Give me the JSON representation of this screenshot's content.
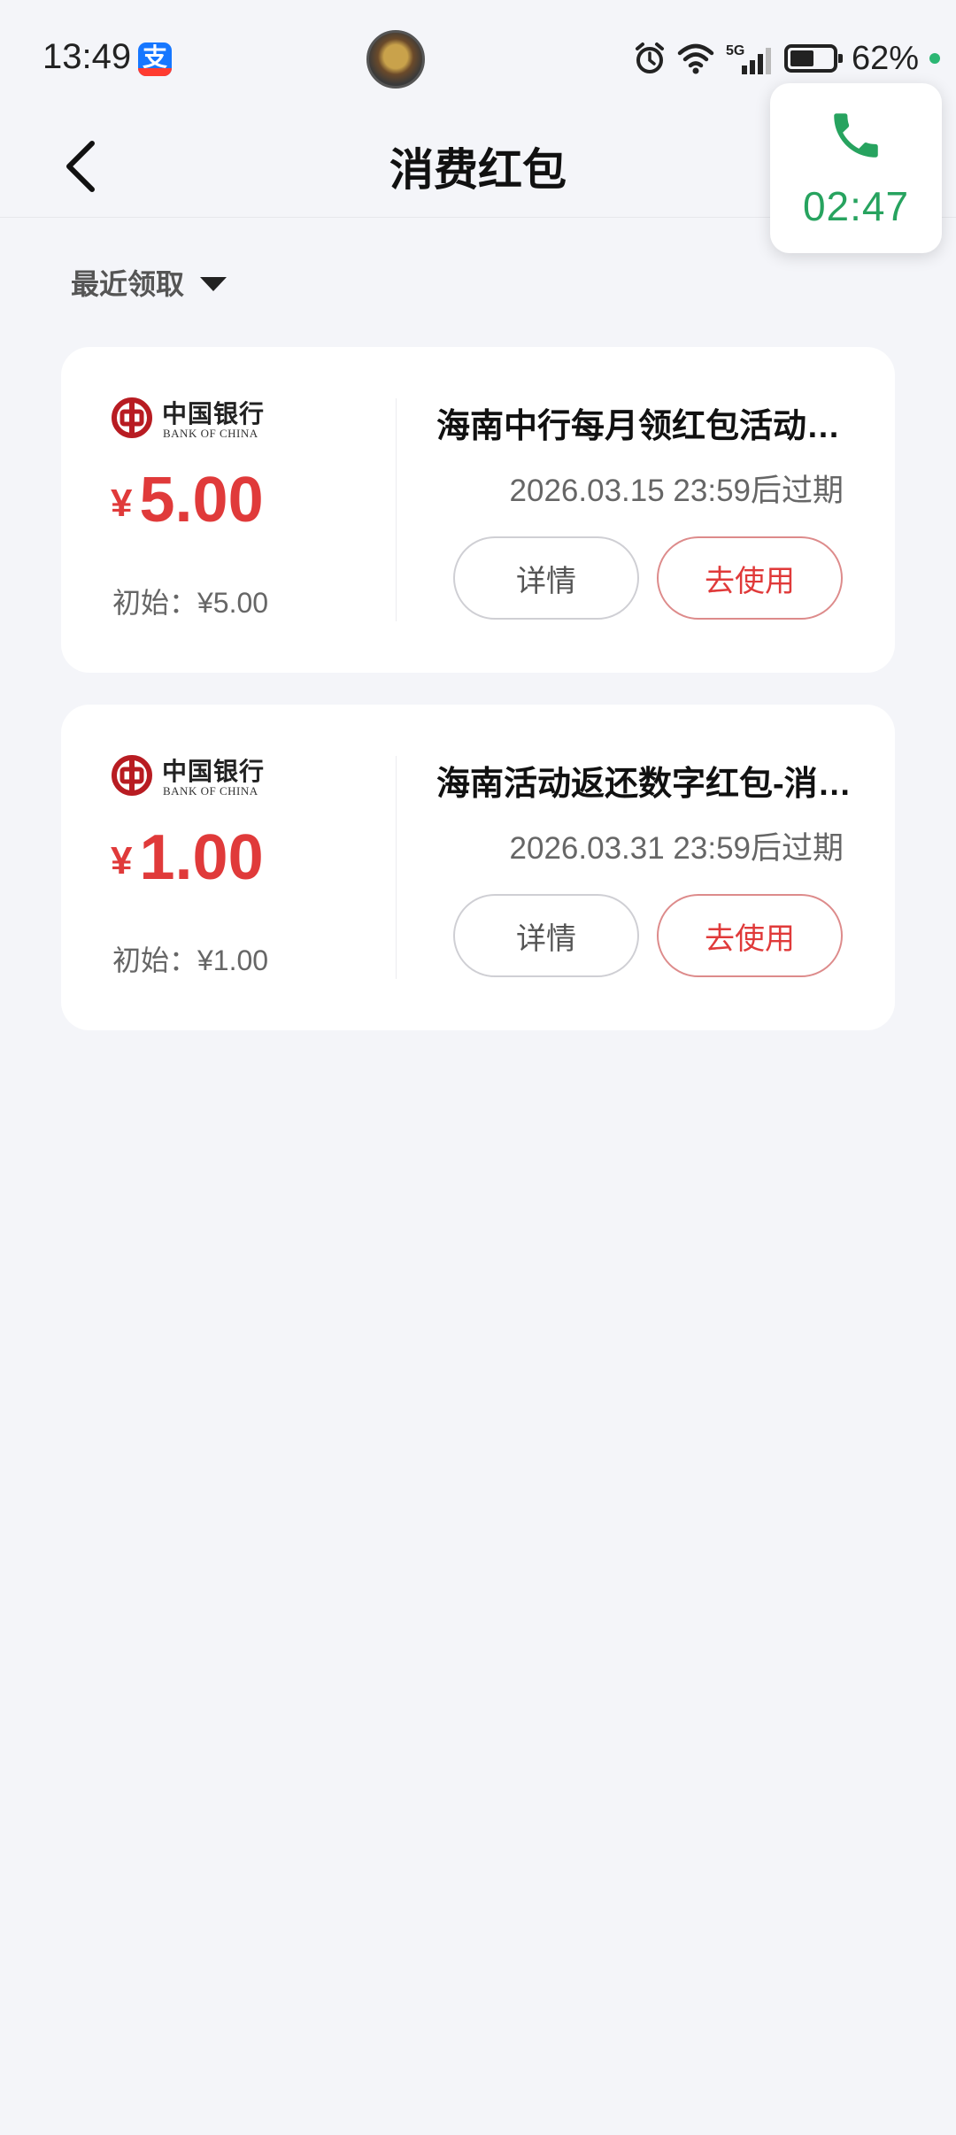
{
  "status_bar": {
    "time": "13:49",
    "alipay_icon_char": "支",
    "battery_percent": "62%",
    "battery_level": 0.62,
    "network_label": "5G"
  },
  "header": {
    "title": "消费红包"
  },
  "call_widget": {
    "duration": "02:47",
    "color": "#27a35f"
  },
  "filter": {
    "sort_label": "最近领取"
  },
  "colors": {
    "accent_red": "#e03a3a",
    "background": "#f4f5f9",
    "bank_red": "#b81c22"
  },
  "coupons": [
    {
      "bank_name_cn": "中国银行",
      "bank_name_en": "BANK OF CHINA",
      "currency": "¥",
      "amount": "5.00",
      "initial": "初始：¥5.00",
      "title": "海南中行每月领红包活动红包",
      "expiry": "2026.03.15 23:59后过期",
      "detail_label": "详情",
      "use_label": "去使用"
    },
    {
      "bank_name_cn": "中国银行",
      "bank_name_en": "BANK OF CHINA",
      "currency": "¥",
      "amount": "1.00",
      "initial": "初始：¥1.00",
      "title": "海南活动返还数字红包-消费红包",
      "expiry": "2026.03.31 23:59后过期",
      "detail_label": "详情",
      "use_label": "去使用"
    }
  ]
}
